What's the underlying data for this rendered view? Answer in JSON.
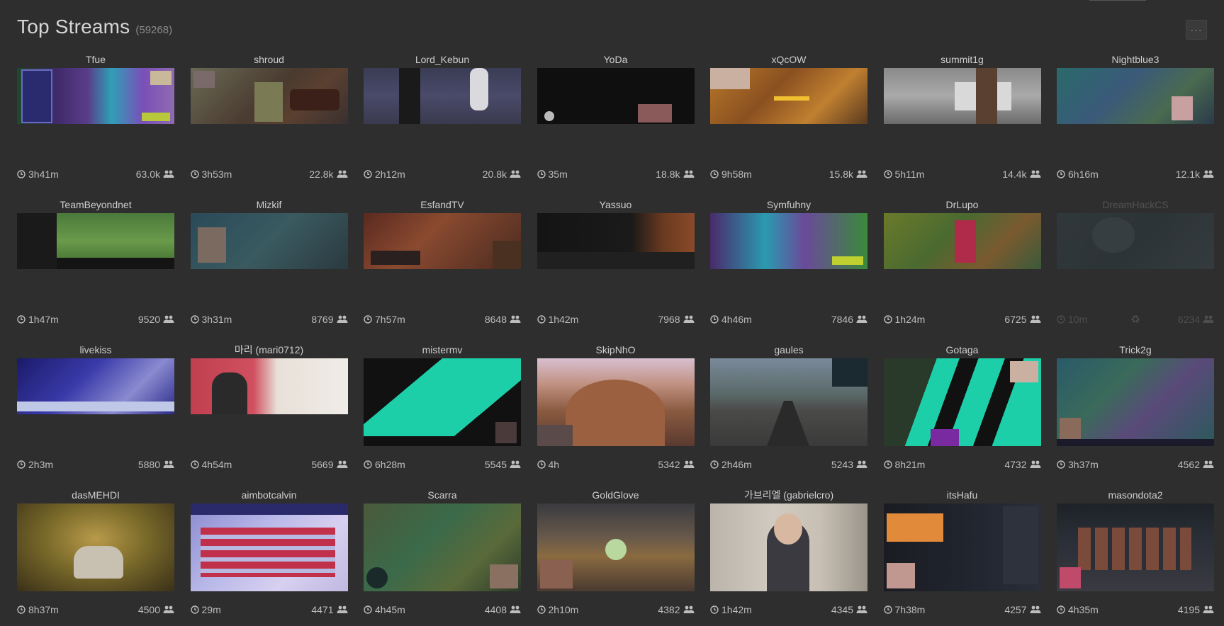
{
  "header": {
    "title": "Top Streams",
    "count": "(59268)",
    "menu_label": "···"
  },
  "colors": {
    "background": "#2e2e2e",
    "text": "#c9c9c9",
    "muted": "#8a8a8a"
  },
  "icons": {
    "clock": "clock-icon",
    "viewers": "users-icon",
    "recycle": "recycle-icon"
  },
  "streams": [
    {
      "name": "Tfue",
      "uptime": "3h41m",
      "viewers": "63.0k"
    },
    {
      "name": "shroud",
      "uptime": "3h53m",
      "viewers": "22.8k"
    },
    {
      "name": "Lord_Kebun",
      "uptime": "2h12m",
      "viewers": "20.8k"
    },
    {
      "name": "YoDa",
      "uptime": "35m",
      "viewers": "18.8k"
    },
    {
      "name": "xQcOW",
      "uptime": "9h58m",
      "viewers": "15.8k"
    },
    {
      "name": "summit1g",
      "uptime": "5h11m",
      "viewers": "14.4k"
    },
    {
      "name": "Nightblue3",
      "uptime": "6h16m",
      "viewers": "12.1k"
    },
    {
      "name": "TeamBeyondnet",
      "uptime": "1h47m",
      "viewers": "9520"
    },
    {
      "name": "Mizkif",
      "uptime": "3h31m",
      "viewers": "8769"
    },
    {
      "name": "EsfandTV",
      "uptime": "7h57m",
      "viewers": "8648"
    },
    {
      "name": "Yassuo",
      "uptime": "1h42m",
      "viewers": "7968"
    },
    {
      "name": "Symfuhny",
      "uptime": "4h46m",
      "viewers": "7846"
    },
    {
      "name": "DrLupo",
      "uptime": "1h24m",
      "viewers": "6725"
    },
    {
      "name": "DreamHackCS",
      "uptime": "10m",
      "viewers": "6234",
      "recycle": "♻"
    },
    {
      "name": "livekiss",
      "uptime": "2h3m",
      "viewers": "5880"
    },
    {
      "name": "마리 (mari0712)",
      "uptime": "4h54m",
      "viewers": "5669"
    },
    {
      "name": "mistermv",
      "uptime": "6h28m",
      "viewers": "5545"
    },
    {
      "name": "SkipNhO",
      "uptime": "4h",
      "viewers": "5342"
    },
    {
      "name": "gaules",
      "uptime": "2h46m",
      "viewers": "5243"
    },
    {
      "name": "Gotaga",
      "uptime": "8h21m",
      "viewers": "4732"
    },
    {
      "name": "Trick2g",
      "uptime": "3h37m",
      "viewers": "4562"
    },
    {
      "name": "dasMEHDI",
      "uptime": "8h37m",
      "viewers": "4500"
    },
    {
      "name": "aimbotcalvin",
      "uptime": "29m",
      "viewers": "4471"
    },
    {
      "name": "Scarra",
      "uptime": "4h45m",
      "viewers": "4408"
    },
    {
      "name": "GoldGlove",
      "uptime": "2h10m",
      "viewers": "4382"
    },
    {
      "name": "가브리엘 (gabrielcro)",
      "uptime": "1h42m",
      "viewers": "4345"
    },
    {
      "name": "itsHafu",
      "uptime": "7h38m",
      "viewers": "4257"
    },
    {
      "name": "masondota2",
      "uptime": "4h35m",
      "viewers": "4195"
    }
  ]
}
